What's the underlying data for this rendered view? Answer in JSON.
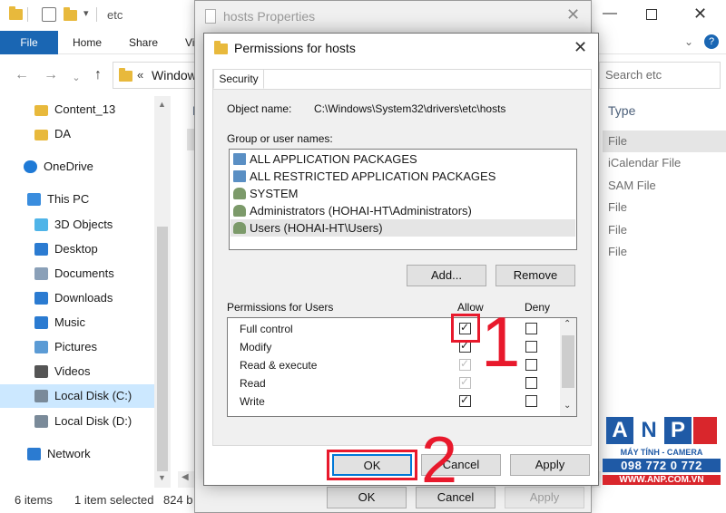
{
  "explorer": {
    "title_path": "etc",
    "ribbon_tabs": [
      "File",
      "Home",
      "Share",
      "Vi"
    ],
    "address_text": "Window",
    "search_placeholder": "Search etc",
    "nav_items": [
      {
        "label": "Content_13",
        "icon": "folder-icon"
      },
      {
        "label": "DA",
        "icon": "folder-icon"
      },
      {
        "label": "OneDrive",
        "icon": "cloud-icon"
      },
      {
        "label": "This PC",
        "icon": "computer-icon"
      },
      {
        "label": "3D Objects",
        "icon": "cube-icon"
      },
      {
        "label": "Desktop",
        "icon": "desktop-icon"
      },
      {
        "label": "Documents",
        "icon": "document-icon"
      },
      {
        "label": "Downloads",
        "icon": "download-icon"
      },
      {
        "label": "Music",
        "icon": "music-icon"
      },
      {
        "label": "Pictures",
        "icon": "picture-icon"
      },
      {
        "label": "Videos",
        "icon": "video-icon"
      },
      {
        "label": "Local Disk (C:)",
        "icon": "drive-icon"
      },
      {
        "label": "Local Disk (D:)",
        "icon": "drive-icon"
      },
      {
        "label": "Network",
        "icon": "network-icon"
      }
    ],
    "column_type": "Type",
    "file_types": [
      "File",
      "iCalendar File",
      "SAM File",
      "File",
      "File",
      "File"
    ],
    "status": {
      "items": "6 items",
      "selected": "1 item selected",
      "size": "824 b"
    }
  },
  "properties": {
    "title": "hosts Properties",
    "buttons": {
      "ok": "OK",
      "cancel": "Cancel",
      "apply": "Apply"
    }
  },
  "permissions": {
    "title": "Permissions for hosts",
    "tab": "Security",
    "object_name_label": "Object name:",
    "object_name_value": "C:\\Windows\\System32\\drivers\\etc\\hosts",
    "group_label": "Group or user names:",
    "users": [
      "ALL APPLICATION PACKAGES",
      "ALL RESTRICTED APPLICATION PACKAGES",
      "SYSTEM",
      "Administrators (HOHAI-HT\\Administrators)",
      "Users (HOHAI-HT\\Users)"
    ],
    "add_label": "Add...",
    "remove_label": "Remove",
    "perm_label": "Permissions for Users",
    "allow_label": "Allow",
    "deny_label": "Deny",
    "rows": [
      {
        "label": "Full control",
        "allow": true,
        "allow_dim": false
      },
      {
        "label": "Modify",
        "allow": true,
        "allow_dim": false
      },
      {
        "label": "Read & execute",
        "allow": true,
        "allow_dim": true
      },
      {
        "label": "Read",
        "allow": true,
        "allow_dim": true
      },
      {
        "label": "Write",
        "allow": true,
        "allow_dim": false
      }
    ],
    "buttons": {
      "ok": "OK",
      "cancel": "Cancel",
      "apply": "Apply"
    }
  },
  "annotations": {
    "step1": "1",
    "step2": "2"
  },
  "logo": {
    "letters": [
      "A",
      "N",
      "P"
    ],
    "tagline": "MÁY TÍNH - CAMERA",
    "phone": "098 772 0 772",
    "website": "WWW.ANP.COM.VN"
  },
  "colors": {
    "accent": "#1a66b3",
    "annotation_red": "#e8192c",
    "logo_blue": "#1f5aa6",
    "logo_red": "#d9262c"
  }
}
